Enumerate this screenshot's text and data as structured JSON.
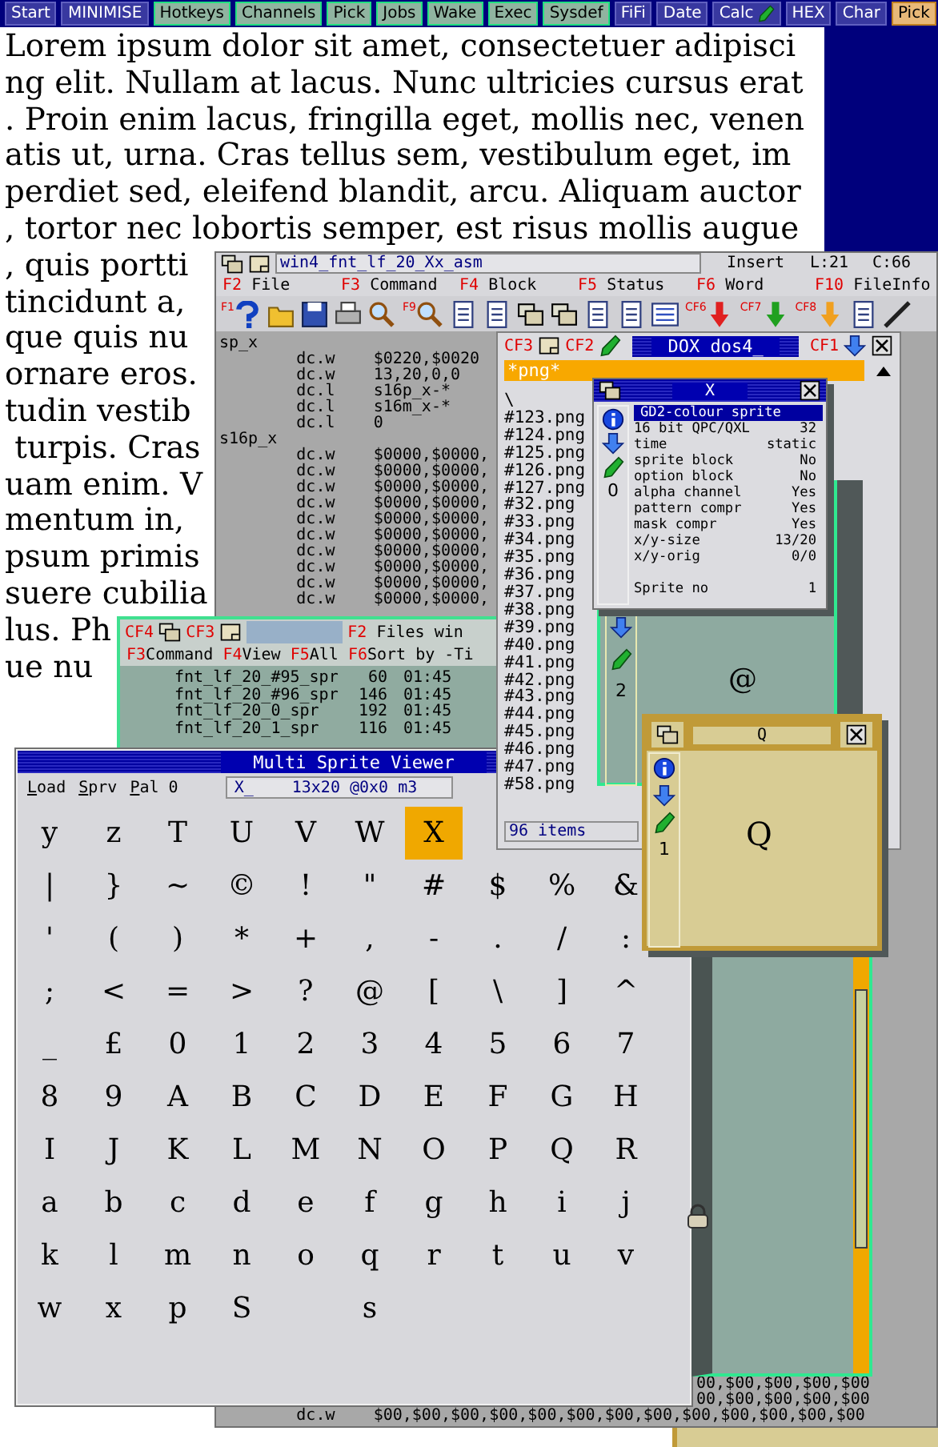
{
  "taskbar": [
    {
      "label": "Start",
      "kind": "system"
    },
    {
      "label": "MINIMISE",
      "kind": "system"
    },
    {
      "label": "Hotkeys",
      "kind": "job"
    },
    {
      "label": "Channels",
      "kind": "job"
    },
    {
      "label": "Pick",
      "kind": "job"
    },
    {
      "label": "Jobs",
      "kind": "job"
    },
    {
      "label": "Wake",
      "kind": "job"
    },
    {
      "label": "Exec",
      "kind": "job"
    },
    {
      "label": "Sysdef",
      "kind": "job"
    },
    {
      "label": "FiFi",
      "kind": "system"
    },
    {
      "label": "Date",
      "kind": "system"
    },
    {
      "label": "Calc",
      "kind": "calc"
    },
    {
      "label": "HEX",
      "kind": "system"
    },
    {
      "label": "Char",
      "kind": "system"
    },
    {
      "label": "Pick",
      "kind": "pick"
    }
  ],
  "document": {
    "lines": [
      "Lorem ipsum dolor sit amet, consectetuer adipisci",
      "ng elit. Nullam at lacus. Nunc ultricies cursus erat",
      ". Proin enim lacus, fringilla eget, mollis nec, venen",
      "atis ut, urna. Cras tellus sem, vestibulum eget, im",
      "perdiet sed, eleifend blandit, arcu. Aliquam auctor",
      ", tortor nec lobortis semper, est risus mollis augue",
      ", quis portti",
      "tincidunt a,",
      "que quis nu",
      "ornare eros.",
      "tudin vestib",
      " turpis. Cras",
      "uam enim. V",
      "mentum in,",
      "psum primis",
      "suere cubilia",
      "lus. Ph",
      "ue nu"
    ]
  },
  "editor": {
    "title": "win4_fnt_lf_20_Xx_asm",
    "mode": "Insert",
    "line": "L:21",
    "column": "C:66",
    "menu": [
      {
        "key": "F2",
        "label": "File"
      },
      {
        "key": "F3",
        "label": "Command"
      },
      {
        "key": "F4",
        "label": "Block"
      },
      {
        "key": "F5",
        "label": "Status"
      },
      {
        "key": "F6",
        "label": "Word"
      },
      {
        "key": "F10",
        "label": "FileInfo"
      }
    ],
    "toolbar": [
      {
        "kind": "help",
        "key": "F1"
      },
      {
        "kind": "folder"
      },
      {
        "kind": "floppy"
      },
      {
        "kind": "printer"
      },
      {
        "kind": "search"
      },
      {
        "kind": "search",
        "key": "F9"
      },
      {
        "kind": "document"
      },
      {
        "kind": "document"
      },
      {
        "kind": "windows"
      },
      {
        "kind": "windows"
      },
      {
        "kind": "document"
      },
      {
        "kind": "document"
      },
      {
        "kind": "list"
      },
      {
        "kind": "red-arrow",
        "key": "CF6"
      },
      {
        "kind": "green-arrow",
        "key": "CF7"
      },
      {
        "kind": "orange-arrow",
        "key": "CF8"
      },
      {
        "kind": "document"
      },
      {
        "kind": "pencil"
      }
    ],
    "code_lines": [
      "sp_x",
      "        dc.w    $0220,$0020",
      "        dc.w    13,20,0,0",
      "        dc.l    s16p_x-*",
      "        dc.l    s16m_x-*",
      "        dc.l    0",
      "s16p_x",
      "        dc.w    $0000,$0000,",
      "        dc.w    $0000,$0000,",
      "        dc.w    $0000,$0000,",
      "        dc.w    $0000,$0000,",
      "        dc.w    $0000,$0000,",
      "        dc.w    $0000,$0000,",
      "        dc.w    $0000,$0000,",
      "        dc.w    $0000,$0000,",
      "        dc.w    $0000,$0000,",
      "        dc.w    $0000,$0000,"
    ],
    "tail_lines": [
      "00,$00,$00,$00,$00",
      "00,$00,$00,$00,$00"
    ],
    "last_line": "        dc.w    $00,$00,$00,$00,$00,$00,$00,$00,$00,$00,$00,$00,$00"
  },
  "sprite_window": {
    "number": "2",
    "glyph": "@"
  },
  "files": {
    "keys": [
      "CF4",
      "CF3"
    ],
    "title_key": "F2",
    "title": "Files win",
    "menu": [
      {
        "key": "F3",
        "label": "Command"
      },
      {
        "key": "F4",
        "label": "View"
      },
      {
        "key": "F5",
        "label": "All"
      },
      {
        "key": "F6",
        "label": "Sort by -Ti"
      }
    ],
    "rows": [
      {
        "name": "fnt_lf_20_#95_spr",
        "size": "60",
        "time": "01:45"
      },
      {
        "name": "fnt_lf_20_#96_spr",
        "size": "146",
        "time": "01:45"
      },
      {
        "name": "fnt_lf_20_0_spr",
        "size": "192",
        "time": "01:45"
      },
      {
        "name": "fnt_lf_20_1_spr",
        "size": "116",
        "time": "01:45"
      }
    ]
  },
  "viewer": {
    "title": "Multi Sprite Viewer",
    "menu": [
      "Load",
      "Sprv",
      "Pal 0"
    ],
    "name": "X_",
    "info": "13x20 @0x0 m3",
    "grid": [
      [
        {
          "char": "y",
          "selected": false
        },
        {
          "char": "z",
          "selected": false
        },
        {
          "char": "T",
          "selected": false
        },
        {
          "char": "U",
          "selected": false
        },
        {
          "char": "V",
          "selected": false
        },
        {
          "char": "W",
          "selected": false
        },
        {
          "char": "X",
          "selected": true
        }
      ],
      [
        {
          "char": "|",
          "selected": false
        },
        {
          "char": "}",
          "selected": false
        },
        {
          "char": "~",
          "selected": false
        },
        {
          "char": "©",
          "selected": false
        },
        {
          "char": "!",
          "selected": false
        },
        {
          "char": "\"",
          "selected": false
        },
        {
          "char": "#",
          "selected": false
        },
        {
          "char": "$",
          "selected": false
        },
        {
          "char": "%",
          "selected": false
        },
        {
          "char": "&",
          "selected": false
        }
      ],
      [
        {
          "char": "'",
          "selected": false
        },
        {
          "char": "(",
          "selected": false
        },
        {
          "char": ")",
          "selected": false
        },
        {
          "char": "*",
          "selected": false
        },
        {
          "char": "+",
          "selected": false
        },
        {
          "char": ",",
          "selected": false
        },
        {
          "char": "-",
          "selected": false
        },
        {
          "char": ".",
          "selected": false
        },
        {
          "char": "/",
          "selected": false
        },
        {
          "char": ":",
          "selected": false
        }
      ],
      [
        {
          "char": ";",
          "selected": false
        },
        {
          "char": "<",
          "selected": false
        },
        {
          "char": "=",
          "selected": false
        },
        {
          "char": ">",
          "selected": false
        },
        {
          "char": "?",
          "selected": false
        },
        {
          "char": "@",
          "selected": false
        },
        {
          "char": "[",
          "selected": false
        },
        {
          "char": "\\",
          "selected": false
        },
        {
          "char": "]",
          "selected": false
        },
        {
          "char": "^",
          "selected": false
        }
      ],
      [
        {
          "char": "_",
          "selected": false
        },
        {
          "char": "£",
          "selected": false
        },
        {
          "char": "0",
          "selected": false
        },
        {
          "char": "1",
          "selected": false
        },
        {
          "char": "2",
          "selected": false
        },
        {
          "char": "3",
          "selected": false
        },
        {
          "char": "4",
          "selected": false
        },
        {
          "char": "5",
          "selected": false
        },
        {
          "char": "6",
          "selected": false
        },
        {
          "char": "7",
          "selected": false
        }
      ],
      [
        {
          "char": "8",
          "selected": false
        },
        {
          "char": "9",
          "selected": false
        },
        {
          "char": "A",
          "selected": false
        },
        {
          "char": "B",
          "selected": false
        },
        {
          "char": "C",
          "selected": false
        },
        {
          "char": "D",
          "selected": false
        },
        {
          "char": "E",
          "selected": false
        },
        {
          "char": "F",
          "selected": false
        },
        {
          "char": "G",
          "selected": false
        },
        {
          "char": "H",
          "selected": false
        }
      ],
      [
        {
          "char": "I",
          "selected": false
        },
        {
          "char": "J",
          "selected": false
        },
        {
          "char": "K",
          "selected": false
        },
        {
          "char": "L",
          "selected": false
        },
        {
          "char": "M",
          "selected": false
        },
        {
          "char": "N",
          "selected": false
        },
        {
          "char": "O",
          "selected": false
        },
        {
          "char": "P",
          "selected": false
        },
        {
          "char": "Q",
          "selected": false
        },
        {
          "char": "R",
          "selected": false
        }
      ],
      [
        {
          "char": "a",
          "selected": false
        },
        {
          "char": "b",
          "selected": false
        },
        {
          "char": "c",
          "selected": false
        },
        {
          "char": "d",
          "selected": false
        },
        {
          "char": "e",
          "selected": false
        },
        {
          "char": "f",
          "selected": false
        },
        {
          "char": "g",
          "selected": false
        },
        {
          "char": "h",
          "selected": false
        },
        {
          "char": "i",
          "selected": false
        },
        {
          "char": "j",
          "selected": false
        }
      ],
      [
        {
          "char": "k",
          "selected": false
        },
        {
          "char": "l",
          "selected": false
        },
        {
          "char": "m",
          "selected": false
        },
        {
          "char": "n",
          "selected": false
        },
        {
          "char": "o",
          "selected": false
        },
        {
          "char": "q",
          "selected": false
        },
        {
          "char": "r",
          "selected": false
        },
        {
          "char": "t",
          "selected": false
        },
        {
          "char": "u",
          "selected": false
        },
        {
          "char": "v",
          "selected": false
        }
      ],
      [
        {
          "char": "w",
          "selected": false
        },
        {
          "char": "x",
          "selected": false
        },
        {
          "char": "p",
          "selected": false
        },
        {
          "char": "S",
          "selected": false
        },
        {
          "blank": true,
          "selected": false
        },
        {
          "char": "s",
          "selected": false
        }
      ]
    ]
  },
  "dox": {
    "keys": [
      "CF3",
      "CF2",
      "CF1"
    ],
    "title": "DOX dos4_",
    "filter": "*png*",
    "items": [
      "\\",
      "#123.png",
      "#124.png",
      "#125.png",
      "#126.png",
      "#127.png",
      "#32.png",
      "#33.png",
      "#34.png",
      "#35.png",
      "#36.png",
      "#37.png",
      "#38.png",
      "#39.png",
      "#40.png",
      "#41.png",
      "#42.png",
      "#43.png",
      "#44.png",
      "#45.png",
      "#46.png",
      "#47.png",
      "#58.png"
    ],
    "status": "96 items"
  },
  "sprite_info": {
    "title": "X",
    "number": "0",
    "heading": "GD2-colour sprite",
    "rows": [
      {
        "label": "16 bit QPC/QXL",
        "value": "32"
      },
      {
        "label": "time",
        "value": "static"
      },
      {
        "label": "sprite block",
        "value": "No"
      },
      {
        "label": "option block",
        "value": "No"
      },
      {
        "label": "alpha channel",
        "value": "Yes"
      },
      {
        "label": "pattern compr",
        "value": "Yes"
      },
      {
        "label": "mask compr",
        "value": "Yes"
      },
      {
        "label": "x/y-size",
        "value": "13/20"
      },
      {
        "label": "x/y-orig",
        "value": "0/0"
      }
    ],
    "footer_label": "Sprite no",
    "footer_value": "1"
  },
  "q_window": {
    "title": "Q",
    "number": "1",
    "glyph": "Q"
  }
}
